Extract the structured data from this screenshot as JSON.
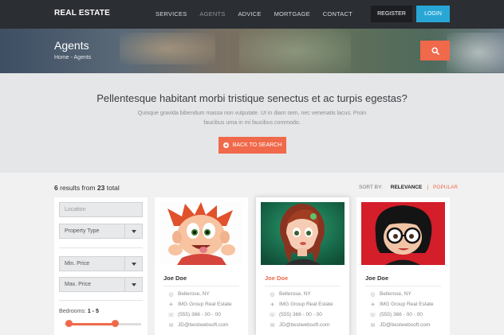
{
  "brand": "REAL ESTATE",
  "nav": [
    {
      "label": "SERVICES",
      "active": false
    },
    {
      "label": "AGENTS",
      "active": true
    },
    {
      "label": "ADVICE",
      "active": false
    },
    {
      "label": "MORTGAGE",
      "active": false
    },
    {
      "label": "CONTACT",
      "active": false
    }
  ],
  "auth": {
    "register": "REGISTER",
    "login": "LOGIN"
  },
  "hero": {
    "title": "Agents",
    "breadcrumb": "Home - Agents"
  },
  "banner": {
    "heading": "Pellentesque habitant morbi tristique senectus et ac turpis egestas?",
    "text": "Quisque gravida bibendum massa non vulputate. Ut in diam sem, nec venenatis lacus. Proin faucibus urna in mi faucibus commodo.",
    "button": "BACK TO SEARCH"
  },
  "results": {
    "count": "6",
    "from": "results from",
    "total": "23",
    "total_label": "total"
  },
  "sort": {
    "label": "SORT BY:",
    "options": [
      "RELEVANCE",
      "POPULAR"
    ]
  },
  "filters": {
    "location_placeholder": "Location",
    "property_type": "Property Type",
    "min_price": "Min. Price",
    "max_price": "Max. Price",
    "bedrooms_label": "Bedrooms:",
    "bedrooms_min": "1",
    "bedrooms_dash": "-",
    "bedrooms_max": "5"
  },
  "agents": [
    {
      "name": "Joe Doe",
      "location": "Bellerose, NY",
      "company": "IMG Group Real Estate",
      "phone": "(555) 366 - 00 - 00",
      "email": "JD@bestwebsoft.com",
      "featured": false
    },
    {
      "name": "Joe Doe",
      "location": "Bellerose, NY",
      "company": "IMG Group Real Estate",
      "phone": "(555) 366 - 00 - 00",
      "email": "JD@bestwebsoft.com",
      "featured": true
    },
    {
      "name": "Joe Doe",
      "location": "Bellerose, NY",
      "company": "IMG Group Real Estate",
      "phone": "(555) 366 - 00 - 00",
      "email": "JD@bestwebsoft.com",
      "featured": false
    }
  ],
  "colors": {
    "accent": "#f0694a",
    "login": "#28a7d6",
    "navbar": "#2b2e33"
  }
}
